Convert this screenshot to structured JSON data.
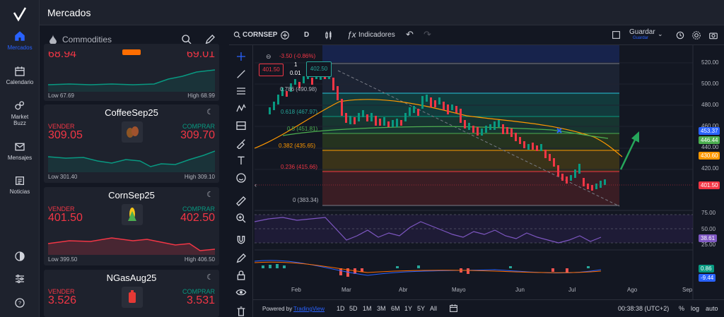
{
  "app": {
    "title": "Mercados"
  },
  "nav": {
    "items": [
      {
        "label": "Mercados"
      },
      {
        "label": "Calendario"
      },
      {
        "label": "Market Buzz"
      },
      {
        "label": "Mensajes"
      },
      {
        "label": "Noticias"
      }
    ]
  },
  "watchlist": {
    "category": "Commodities",
    "cards": [
      {
        "name": "",
        "sell_price": "68.94",
        "buy_price": "69.01",
        "low": "Low 67.69",
        "high": "High 68.99",
        "sell_label": "",
        "buy_label": ""
      },
      {
        "name": "CoffeeSep25",
        "sell_label": "VENDER",
        "buy_label": "COMPRAR",
        "sell_price": "309.05",
        "buy_price": "309.70",
        "low": "Low 301.40",
        "high": "High 309.10"
      },
      {
        "name": "CornSep25",
        "sell_label": "VENDER",
        "buy_label": "COMPRAR",
        "sell_price": "401.50",
        "buy_price": "402.50",
        "low": "Low 399.50",
        "high": "High 406.50"
      },
      {
        "name": "NGasAug25",
        "sell_label": "VENDER",
        "buy_label": "COMPRAR",
        "sell_price": "3.526",
        "buy_price": "3.531",
        "low": "",
        "high": ""
      }
    ]
  },
  "toolbar": {
    "symbol": "CORNSEP",
    "interval": "D",
    "indicators": "Indicadores",
    "save": "Guardar",
    "save_sub": "Guardar"
  },
  "chart": {
    "change": "-3.50 (-0.86%)",
    "sell_box": "401.50",
    "spread": "1",
    "spread_dec": "0.01",
    "buy_box": "402.50",
    "fib": [
      {
        "label": "0.786 (490.98)"
      },
      {
        "label": "0.618 (467.97)"
      },
      {
        "label": "0.5 (451.81)"
      },
      {
        "label": "0.382 (435.65)"
      },
      {
        "label": "0.236 (415.66)"
      },
      {
        "label": "0 (383.34)"
      }
    ],
    "price_ticks": [
      "520.00",
      "500.00",
      "480.00",
      "460.00",
      "440.00",
      "420.00"
    ],
    "price_labels": [
      {
        "v": "453.37",
        "color": "#2962ff"
      },
      {
        "v": "446.44",
        "color": "#4caf50"
      },
      {
        "v": "430.60",
        "color": "#ff9800"
      },
      {
        "v": "401.50",
        "color": "#f23645"
      }
    ],
    "rsi_ticks": [
      "75.00",
      "50.00",
      "25.00"
    ],
    "rsi_value": "38.61",
    "macd_values": [
      "0.86",
      "-9.44"
    ],
    "months": [
      "Feb",
      "Mar",
      "Abr",
      "Mayo",
      "Jun",
      "Jul",
      "Ago",
      "Sep"
    ]
  },
  "bottom": {
    "powered": "Powered by",
    "tv": "TradingView",
    "ranges": [
      "1D",
      "5D",
      "1M",
      "3M",
      "6M",
      "1Y",
      "5Y",
      "All"
    ],
    "time": "00:38:38 (UTC+2)",
    "pct": "%",
    "log": "log",
    "auto": "auto"
  }
}
